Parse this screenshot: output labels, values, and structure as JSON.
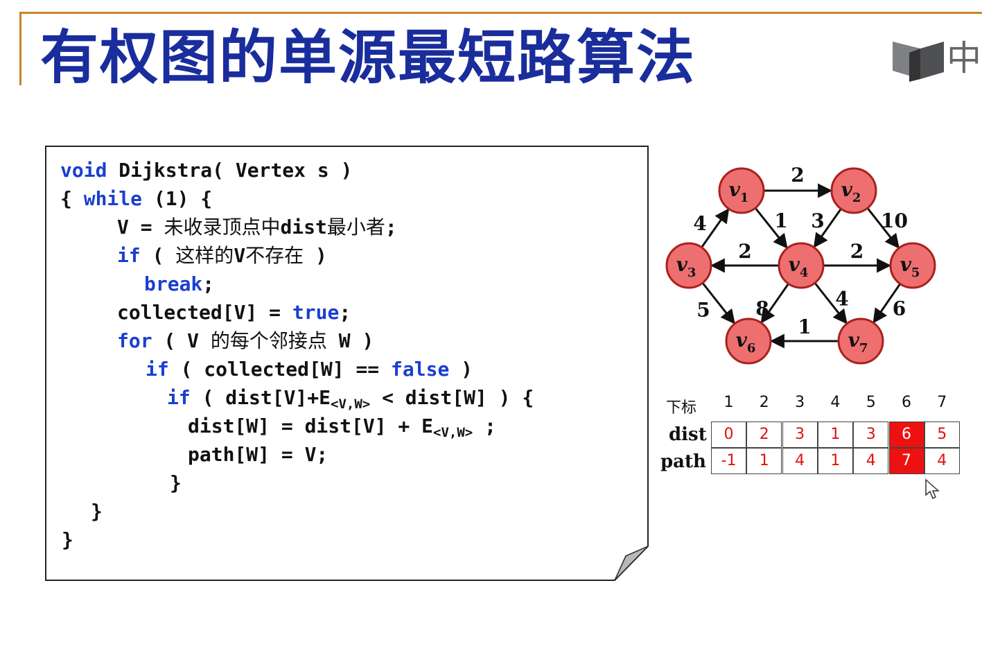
{
  "title": "有权图的单源最短路算法",
  "logo": {
    "text": "中"
  },
  "code": {
    "l1": {
      "kw": "void",
      "rest": " Dijkstra( Vertex s )"
    },
    "l2": {
      "a": "{ ",
      "kw": "while",
      "b": " (1) {"
    },
    "l3": {
      "a": "V = ",
      "cn": "未收录顶点中",
      "b": "dist",
      "cn2": "最小者",
      "c": ";"
    },
    "l4": {
      "kw": "if",
      "a": " ( ",
      "cn": "这样的",
      "b": "V",
      "cn2": "不存在",
      "c": " )"
    },
    "l5": {
      "kw": "break",
      "a": ";"
    },
    "l6": {
      "a": "collected[V] = ",
      "kw": "true",
      "b": ";"
    },
    "l7": {
      "kw": "for",
      "a": " ( V ",
      "cn": "的每个邻接点",
      "b": " W )"
    },
    "l8": {
      "kw": "if",
      "a": " ( collected[W] == ",
      "kw2": "false",
      "b": " )"
    },
    "l9": {
      "kw": "if",
      "a": " ( dist[V]+E",
      "sub": "<V,W>",
      "b": " < dist[W] ) {"
    },
    "l10": {
      "a": "dist[W] = dist[V] + E",
      "sub": "<V,W>",
      "b": " ;"
    },
    "l11": {
      "a": "path[W] = V;"
    },
    "l12": {
      "a": "}"
    },
    "l13": {
      "a": "}"
    },
    "l14": {
      "a": "}"
    }
  },
  "graph": {
    "nodes": [
      {
        "id": "v1",
        "letter": "v",
        "index": "1"
      },
      {
        "id": "v2",
        "letter": "v",
        "index": "2"
      },
      {
        "id": "v3",
        "letter": "v",
        "index": "3"
      },
      {
        "id": "v4",
        "letter": "v",
        "index": "4"
      },
      {
        "id": "v5",
        "letter": "v",
        "index": "5"
      },
      {
        "id": "v6",
        "letter": "v",
        "index": "6"
      },
      {
        "id": "v7",
        "letter": "v",
        "index": "7"
      }
    ],
    "edges": [
      {
        "from": "v1",
        "to": "v2",
        "weight": "2"
      },
      {
        "from": "v1",
        "to": "v4",
        "weight": "1"
      },
      {
        "from": "v2",
        "to": "v4",
        "weight": "3"
      },
      {
        "from": "v2",
        "to": "v5",
        "weight": "10"
      },
      {
        "from": "v3",
        "to": "v1",
        "weight": "4"
      },
      {
        "from": "v4",
        "to": "v3",
        "weight": "2"
      },
      {
        "from": "v4",
        "to": "v5",
        "weight": "2"
      },
      {
        "from": "v3",
        "to": "v6",
        "weight": "5"
      },
      {
        "from": "v4",
        "to": "v6",
        "weight": "8"
      },
      {
        "from": "v4",
        "to": "v7",
        "weight": "4"
      },
      {
        "from": "v5",
        "to": "v7",
        "weight": "6"
      },
      {
        "from": "v7",
        "to": "v6",
        "weight": "1"
      }
    ],
    "node_fill": "#ee6f6f",
    "node_stroke": "#a82020"
  },
  "table": {
    "index_label": "下标",
    "dist_label": "dist",
    "path_label": "path",
    "indices": [
      "1",
      "2",
      "3",
      "4",
      "5",
      "6",
      "7"
    ],
    "dist": [
      "0",
      "2",
      "3",
      "1",
      "3",
      "6",
      "5"
    ],
    "path": [
      "-1",
      "1",
      "4",
      "1",
      "4",
      "7",
      "4"
    ],
    "highlight_col": 6,
    "highlight_color": "#ee1111",
    "value_color": "#e01010"
  }
}
